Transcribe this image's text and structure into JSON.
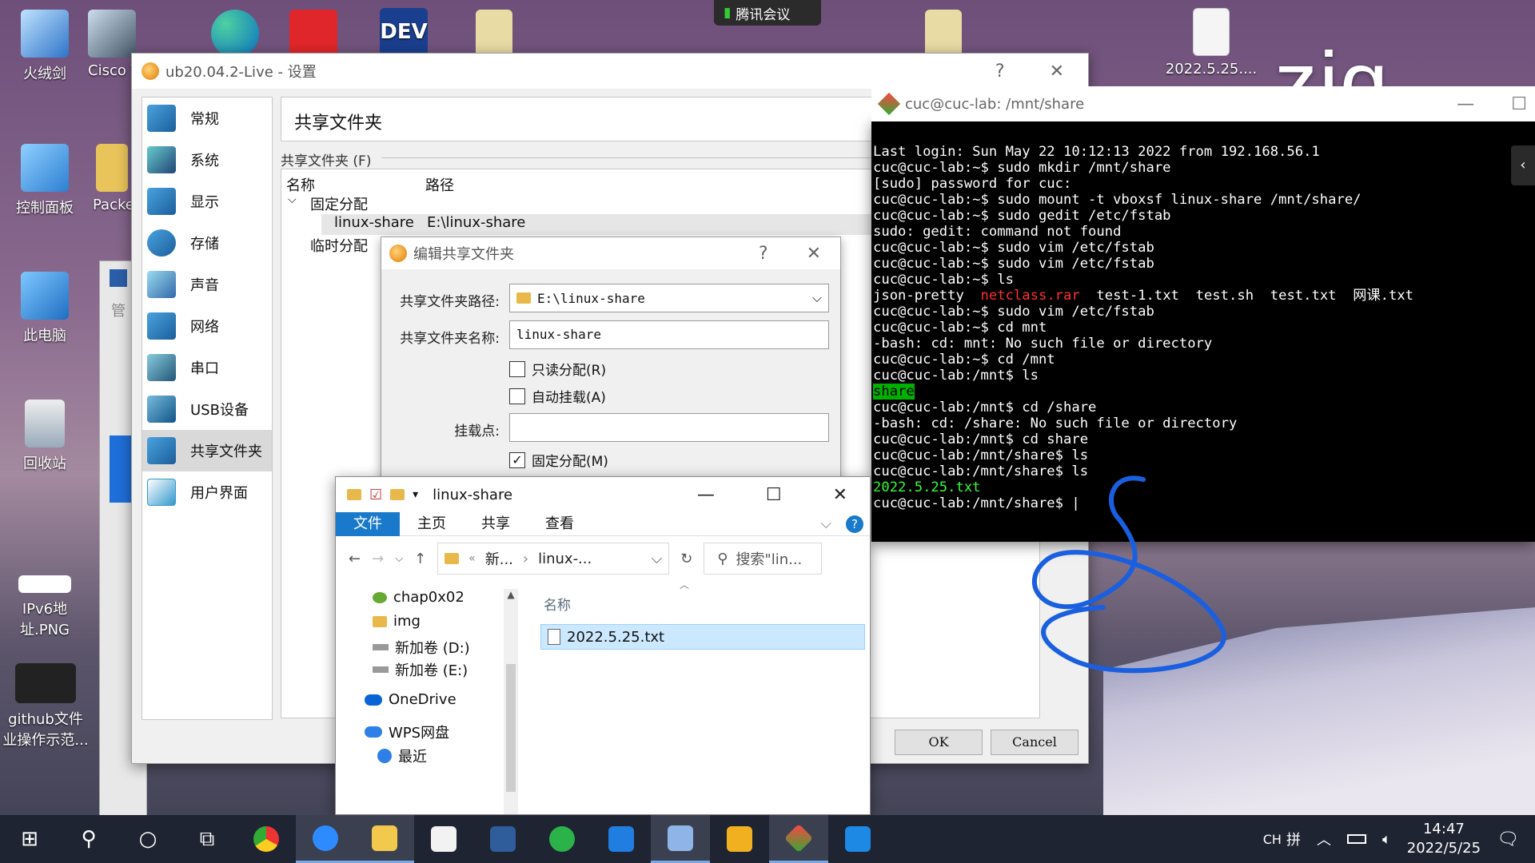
{
  "desktop": {
    "watermark": "zjq",
    "meeting_label": "腾讯会议",
    "icons": [
      {
        "label": "火绒剑"
      },
      {
        "label": "Cisco Tra"
      },
      {
        "label": "控制面板"
      },
      {
        "label": "Packe"
      },
      {
        "label": "此电脑"
      },
      {
        "label": "回收站"
      },
      {
        "label": "IPv6地址.PNG"
      },
      {
        "label": "github文件业操作示范..."
      },
      {
        "label": "2022.5.25...."
      },
      {
        "label": "管"
      }
    ]
  },
  "settings": {
    "title": "ub20.04.2-Live - 设置",
    "help": "?",
    "close": "✕",
    "nav": [
      {
        "label": "常规"
      },
      {
        "label": "系统"
      },
      {
        "label": "显示"
      },
      {
        "label": "存储"
      },
      {
        "label": "声音"
      },
      {
        "label": "网络"
      },
      {
        "label": "串口"
      },
      {
        "label": "USB设备"
      },
      {
        "label": "共享文件夹"
      },
      {
        "label": "用户界面"
      }
    ],
    "page_title": "共享文件夹",
    "group_label": "共享文件夹 (F)",
    "col_name": "名称",
    "col_path": "路径",
    "fixed_group": "固定分配",
    "row_name": "linux-share",
    "row_path": "E:\\linux-share",
    "temp_group": "临时分配",
    "ok": "OK",
    "cancel": "Cancel"
  },
  "edit_dialog": {
    "title": "编辑共享文件夹",
    "help": "?",
    "close": "✕",
    "path_label": "共享文件夹路径:",
    "path_value": "E:\\linux-share",
    "name_label": "共享文件夹名称:",
    "name_value": "linux-share",
    "readonly_label": "只读分配(R)",
    "automount_label": "自动挂载(A)",
    "mountpoint_label": "挂载点:",
    "mountpoint_value": "",
    "permanent_label": "固定分配(M)",
    "permanent_checked": "✓"
  },
  "terminal": {
    "title": "cuc@cuc-lab: /mnt/share",
    "lines": [
      "Last login: Sun May 22 10:12:13 2022 from 192.168.56.1",
      "cuc@cuc-lab:~$ sudo mkdir /mnt/share",
      "[sudo] password for cuc:",
      "cuc@cuc-lab:~$ sudo mount -t vboxsf linux-share /mnt/share/",
      "cuc@cuc-lab:~$ sudo gedit /etc/fstab",
      "sudo: gedit: command not found",
      "cuc@cuc-lab:~$ sudo vim /etc/fstab",
      "cuc@cuc-lab:~$ sudo vim /etc/fstab",
      "cuc@cuc-lab:~$ ls"
    ],
    "ls_items": [
      "json-pretty",
      "netclass.rar",
      "test-1.txt",
      "test.sh",
      "test.txt",
      "网课.txt"
    ],
    "lines2": [
      "cuc@cuc-lab:~$ sudo vim /etc/fstab",
      "cuc@cuc-lab:~$ cd mnt",
      "-bash: cd: mnt: No such file or directory",
      "cuc@cuc-lab:~$ cd /mnt",
      "cuc@cuc-lab:/mnt$ ls"
    ],
    "share_dir": "share",
    "lines3": [
      "cuc@cuc-lab:/mnt$ cd /share",
      "-bash: cd: /share: No such file or directory",
      "cuc@cuc-lab:/mnt$ cd share",
      "cuc@cuc-lab:/mnt/share$ ls",
      "cuc@cuc-lab:/mnt/share$ ls"
    ],
    "file_listed": "2022.5.25.txt",
    "prompt": "cuc@cuc-lab:/mnt/share$ "
  },
  "explorer": {
    "title": "linux-share",
    "tabs": [
      "文件",
      "主页",
      "共享",
      "查看"
    ],
    "breadcrumb_1": "新...",
    "breadcrumb_2": "linux-...",
    "search_placeholder": "搜索\"lin...",
    "nav_items": [
      {
        "label": "chap0x02"
      },
      {
        "label": "img"
      },
      {
        "label": "新加卷 (D:)"
      },
      {
        "label": "新加卷 (E:)"
      },
      {
        "label": "OneDrive"
      },
      {
        "label": "WPS网盘"
      },
      {
        "label": "最近"
      }
    ],
    "col_name": "名称",
    "files": [
      {
        "name": "2022.5.25.txt"
      }
    ]
  },
  "taskbar": {
    "ime": "CH",
    "ime2": "拼",
    "time": "14:47",
    "date": "2022/5/25"
  },
  "colors": {
    "accent": "#1979ca",
    "terminal_red": "#ff3030",
    "terminal_green": "#33ff33",
    "annotation_blue": "#1a5fe0"
  }
}
